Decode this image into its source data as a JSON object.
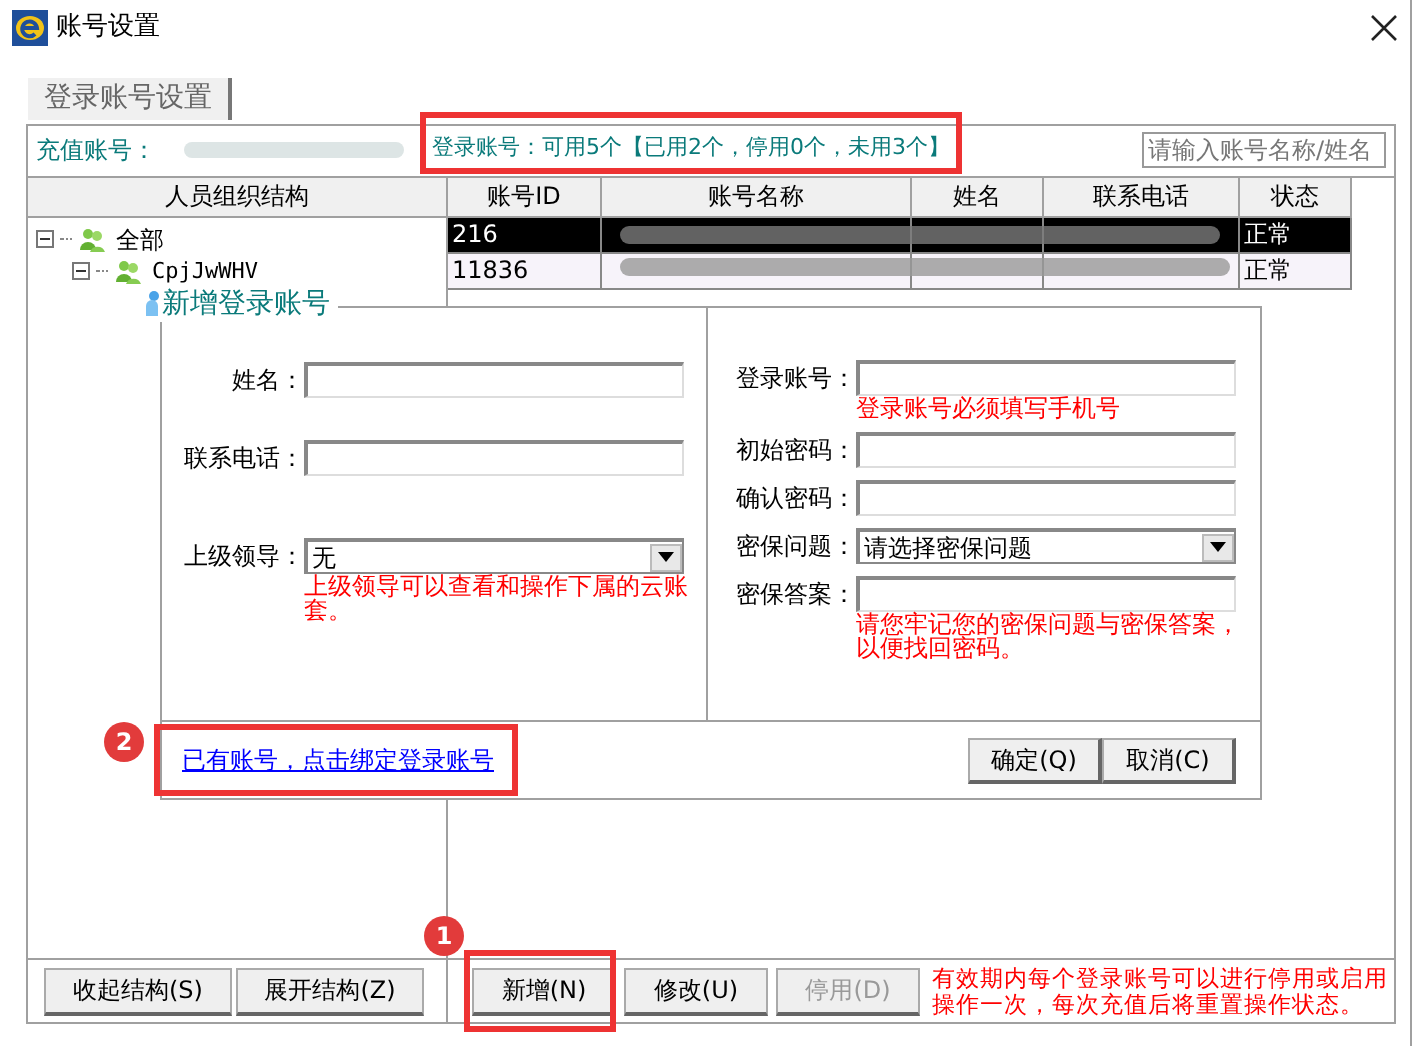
{
  "window": {
    "title": "账号设置"
  },
  "tabs": [
    {
      "label": "登录账号设置",
      "selected": true
    }
  ],
  "info_bar": {
    "recharge_label": "充值账号：",
    "login_summary": "登录账号：可用5个【已用2个，停用0个，未用3个】",
    "search": {
      "placeholder": "请输入账号名称/姓名"
    }
  },
  "tree": {
    "header": "人员组织结构",
    "items": [
      {
        "label": "全部",
        "expanded": true,
        "children": [
          {
            "label": "CpjJwWHV",
            "expanded": true
          }
        ]
      }
    ]
  },
  "table": {
    "columns": [
      "账号ID",
      "账号名称",
      "姓名",
      "联系电话",
      "状态"
    ],
    "rows": [
      {
        "id": "216",
        "status": "正常",
        "selected": true
      },
      {
        "id": "11836",
        "status": "正常",
        "selected": false
      }
    ]
  },
  "dialog": {
    "title": "新增登录账号",
    "left_fields": [
      {
        "kind": "input",
        "label": "姓名："
      },
      {
        "kind": "input",
        "label": "联系电话："
      },
      {
        "kind": "select",
        "label": "上级领导：",
        "value": "无",
        "hint": "上级领导可以查看和操作下属的云账套。"
      }
    ],
    "right_fields": [
      {
        "kind": "input",
        "label": "登录账号：",
        "hint": "登录账号必须填写手机号"
      },
      {
        "kind": "input",
        "label": "初始密码："
      },
      {
        "kind": "input",
        "label": "确认密码："
      },
      {
        "kind": "select",
        "label": "密保问题：",
        "value": "请选择密保问题"
      },
      {
        "kind": "input",
        "label": "密保答案：",
        "hint": "请您牢记您的密保问题与密保答案，以便找回密码。"
      }
    ],
    "link": "已有账号，点击绑定登录账号",
    "buttons": [
      "确定(Q)",
      "取消(C)"
    ]
  },
  "bottom_left_buttons": [
    {
      "label": "收起结构(S)",
      "disabled": false
    },
    {
      "label": "展开结构(Z)",
      "disabled": false
    }
  ],
  "bottom_buttons": [
    {
      "label": "新增(N)",
      "disabled": false
    },
    {
      "label": "修改(U)",
      "disabled": false
    },
    {
      "label": "停用(D)",
      "disabled": true
    }
  ],
  "bottom_note": "有效期内每个登录账号可以进行停用或启用操作一次，每次充值后将重置操作状态。",
  "annotations": [
    {
      "number": "2"
    },
    {
      "number": "1"
    }
  ]
}
